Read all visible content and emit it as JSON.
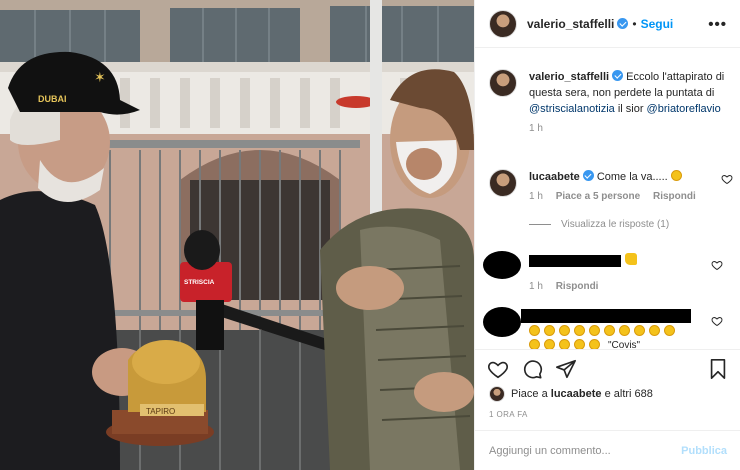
{
  "post": {
    "author": "valerio_staffelli",
    "follow_label": "Segui",
    "separator": "•",
    "more_label": "•••",
    "hat_text": "DUBAI",
    "trophy_text": "TAPIRO",
    "mic_text": "STRISCIA"
  },
  "caption": {
    "author": "valerio_staffelli",
    "text_before": "Eccolo l'attapirato di questa sera, non perdete la puntata di",
    "mention1": "@striscialanotizia",
    "text_middle": "il sior",
    "mention2": "@briatoreflavio",
    "time": "1 h"
  },
  "comment1": {
    "author": "lucaabete",
    "text": "Come la va.....",
    "time": "1 h",
    "likes": "Piace a 5 persone",
    "reply": "Rispondi",
    "view_replies": "Visualizza le risposte (1)"
  },
  "comment2": {
    "time": "1 h",
    "reply": "Rispondi"
  },
  "comment3": {
    "text_fragment": "\"Covis\""
  },
  "likes_line": {
    "prefix": "Piace a",
    "user": "lucaabete",
    "suffix": "e altri 688"
  },
  "timestamp": "1 ORA FA",
  "composer": {
    "placeholder": "Aggiungi un commento...",
    "publish": "Pubblica"
  },
  "colors": {
    "link_blue": "#0095f6",
    "mention": "#00376b",
    "muted": "#8e8e8e",
    "publish_disabled": "#b2dffc"
  },
  "icons": [
    "heart-icon",
    "comment-icon",
    "share-icon",
    "bookmark-icon",
    "verified-icon",
    "more-icon"
  ]
}
